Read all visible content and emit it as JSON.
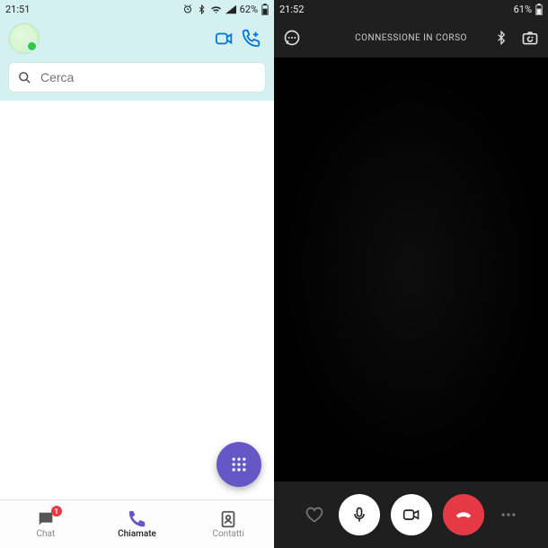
{
  "left": {
    "status": {
      "time": "21:51",
      "battery": "62%"
    },
    "search_placeholder": "Cerca",
    "nav": {
      "chat": "Chat",
      "chat_badge": "1",
      "calls": "Chiamate",
      "contacts": "Contatti"
    }
  },
  "right": {
    "status": {
      "time": "21:52",
      "battery": "61%"
    },
    "call_status": "CONNESSIONE IN CORSO"
  }
}
